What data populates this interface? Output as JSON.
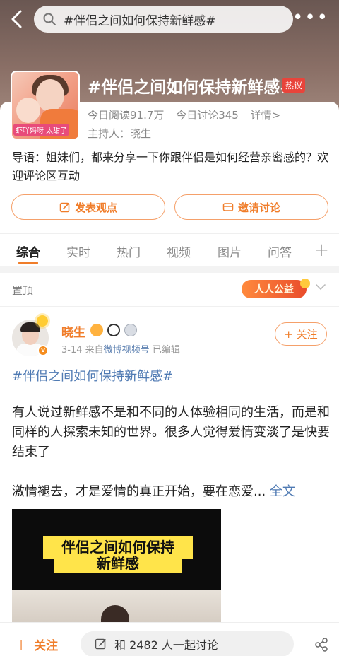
{
  "header": {
    "search_text": "#伴侣之间如何保持新鲜感#",
    "more_label": "•••"
  },
  "topic": {
    "title": "#伴侣之间如何保持新鲜感#",
    "hot_badge": "热议",
    "cover_caption": "虾吖妈呀 太甜了",
    "reads": "今日阅读91.7万",
    "discussions": "今日讨论345",
    "details": "详情>",
    "host": "主持人：晓生",
    "intro": "导语：姐妹们，都来分享一下你跟伴侣是如何经营亲密感的？欢迎评论区互动"
  },
  "actions": {
    "post": "发表观点",
    "invite": "邀请讨论"
  },
  "tabs": [
    "综合",
    "实时",
    "热门",
    "视频",
    "图片",
    "问答"
  ],
  "pinned": {
    "label": "置顶",
    "welfare": "人人公益"
  },
  "post": {
    "author": "晓生",
    "author_badge": "v",
    "date": "3-14",
    "source_prefix": "来自",
    "source": "微博视频号",
    "edited": "已编辑",
    "follow": "+ 关注",
    "hashtag": "#伴侣之间如何保持新鲜感#",
    "paragraph1": "有人说过新鲜感不是和不同的人体验相同的生活，而是和同样的人探索未知的世界。很多人觉得爱情变淡了是快要结束了",
    "paragraph2": "激情褪去，才是爱情的真正开始，要在恋爱...",
    "full_text": "全文",
    "video_caption_line1": "伴侣之间如何保持",
    "video_caption_line2": "新鲜感"
  },
  "bottom": {
    "follow": "关注",
    "follow_plus": "+",
    "discuss": "和 2482 人一起讨论"
  },
  "colors": {
    "accent": "#f07d2a",
    "link": "#4f7ab3",
    "hot": "#e8443b"
  }
}
